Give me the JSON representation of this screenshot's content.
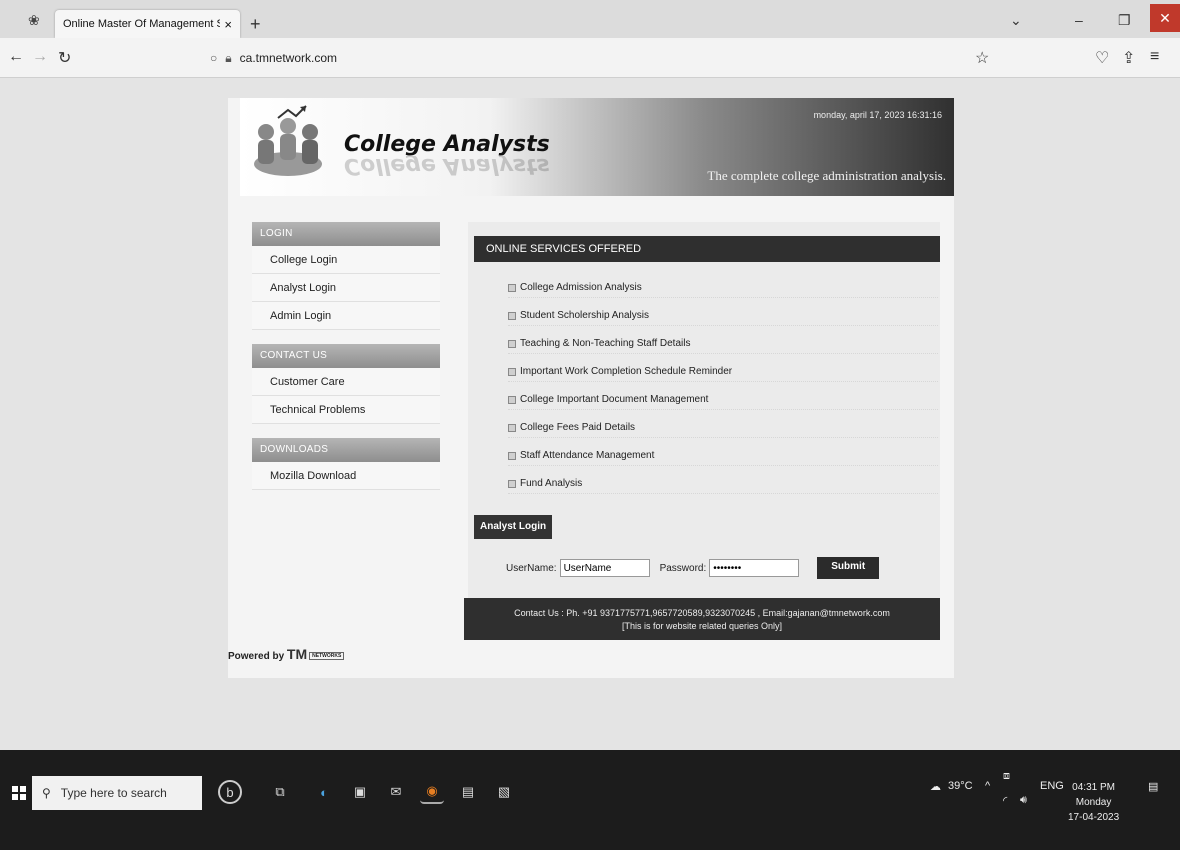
{
  "browser": {
    "tab_title": "Online Master Of Management Syst",
    "tab_close": "×",
    "new_tab": "+",
    "url": "ca.tmnetwork.com",
    "min": "–",
    "max": "❐",
    "close": "✕"
  },
  "site": {
    "brand": "College Analysts",
    "datetime": "monday, april 17, 2023 16:31:16",
    "tagline": "The complete college administration analysis.",
    "sidebar": {
      "login_head": "LOGIN",
      "login_items": [
        "College Login",
        "Analyst Login",
        "Admin Login"
      ],
      "contact_head": "CONTACT US",
      "contact_items": [
        "Customer Care",
        "Technical Problems"
      ],
      "downloads_head": "DOWNLOADS",
      "download_items": [
        "Mozilla Download"
      ]
    },
    "services": {
      "heading": "ONLINE SERVICES OFFERED",
      "items": [
        "College Admission Analysis",
        "Student Scholership Analysis",
        "Teaching & Non-Teaching Staff Details",
        "Important Work Completion Schedule Reminder",
        "College Important Document Management",
        "College Fees Paid Details",
        "Staff Attendance Management",
        "Fund Analysis"
      ]
    },
    "login_form": {
      "tab": "Analyst Login",
      "username_label": "UserName:",
      "username_value": "UserName",
      "password_label": "Password:",
      "password_value": "••••••••",
      "submit": "Submit"
    },
    "contact_line1": "Contact Us : Ph. +91 9371775771,9657720589,9323070245 , Email:gajanan@tmnetwork.com",
    "contact_line2": "[This is for website related queries Only]",
    "powered_by": "Powered by",
    "powered_tm": "TM",
    "powered_network": "NETWORKS"
  },
  "taskbar": {
    "search_placeholder": "Type here to search",
    "weather": "39°C",
    "lang": "ENG",
    "time": "04:31 PM",
    "day": "Monday",
    "date": "17-04-2023"
  }
}
